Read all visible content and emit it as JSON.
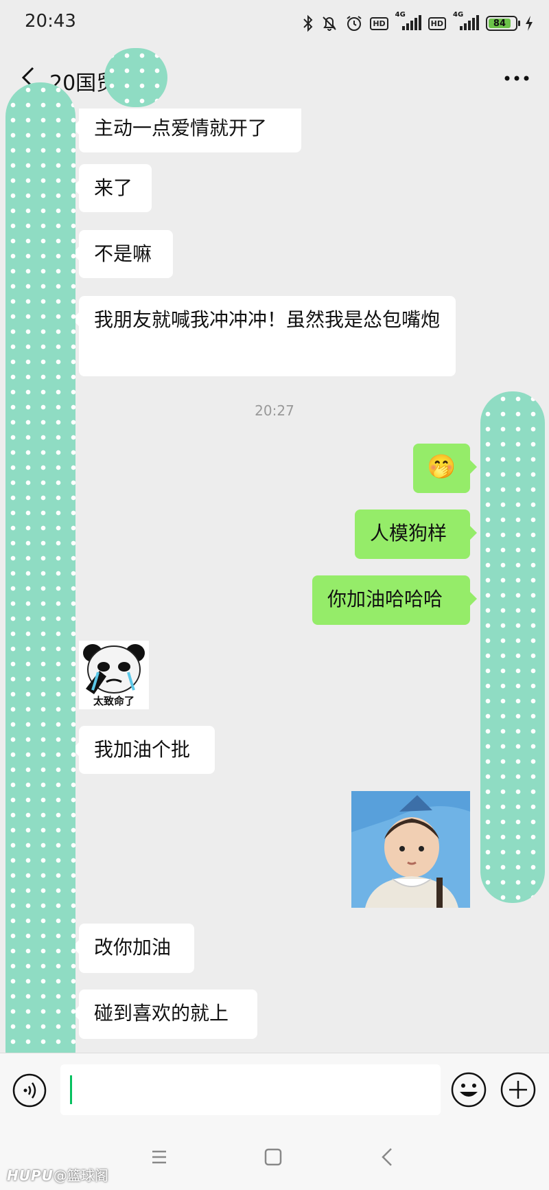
{
  "status_bar": {
    "time": "20:43",
    "battery": "84",
    "hd": "HD",
    "network": "4G"
  },
  "header": {
    "title": "20国贸"
  },
  "messages": [
    {
      "side": "in",
      "text": "主动一点爱情就开了"
    },
    {
      "side": "in",
      "text": "来了"
    },
    {
      "side": "in",
      "text": "不是嘛"
    },
    {
      "side": "in",
      "text": "我朋友就喊我冲冲冲！虽然我是怂包嘴炮"
    },
    {
      "type": "time",
      "text": "20:27"
    },
    {
      "side": "out",
      "emoji": "🤭"
    },
    {
      "side": "out",
      "text": "人模狗样"
    },
    {
      "side": "out",
      "text": "你加油哈哈哈"
    },
    {
      "side": "in",
      "sticker_caption": "太致命了"
    },
    {
      "side": "in",
      "text": "我加油个批"
    },
    {
      "side": "out",
      "type": "image"
    },
    {
      "side": "in",
      "text": "改你加油"
    },
    {
      "side": "in",
      "text": "碰到喜欢的就上"
    }
  ],
  "watermark": {
    "brand": "HUPU",
    "handle": "@篮球阁"
  },
  "colors": {
    "outgoing_bubble": "#95ec69",
    "incoming_bubble": "#ffffff",
    "background": "#ededed",
    "privacy_mask": "#8fdcc3"
  }
}
